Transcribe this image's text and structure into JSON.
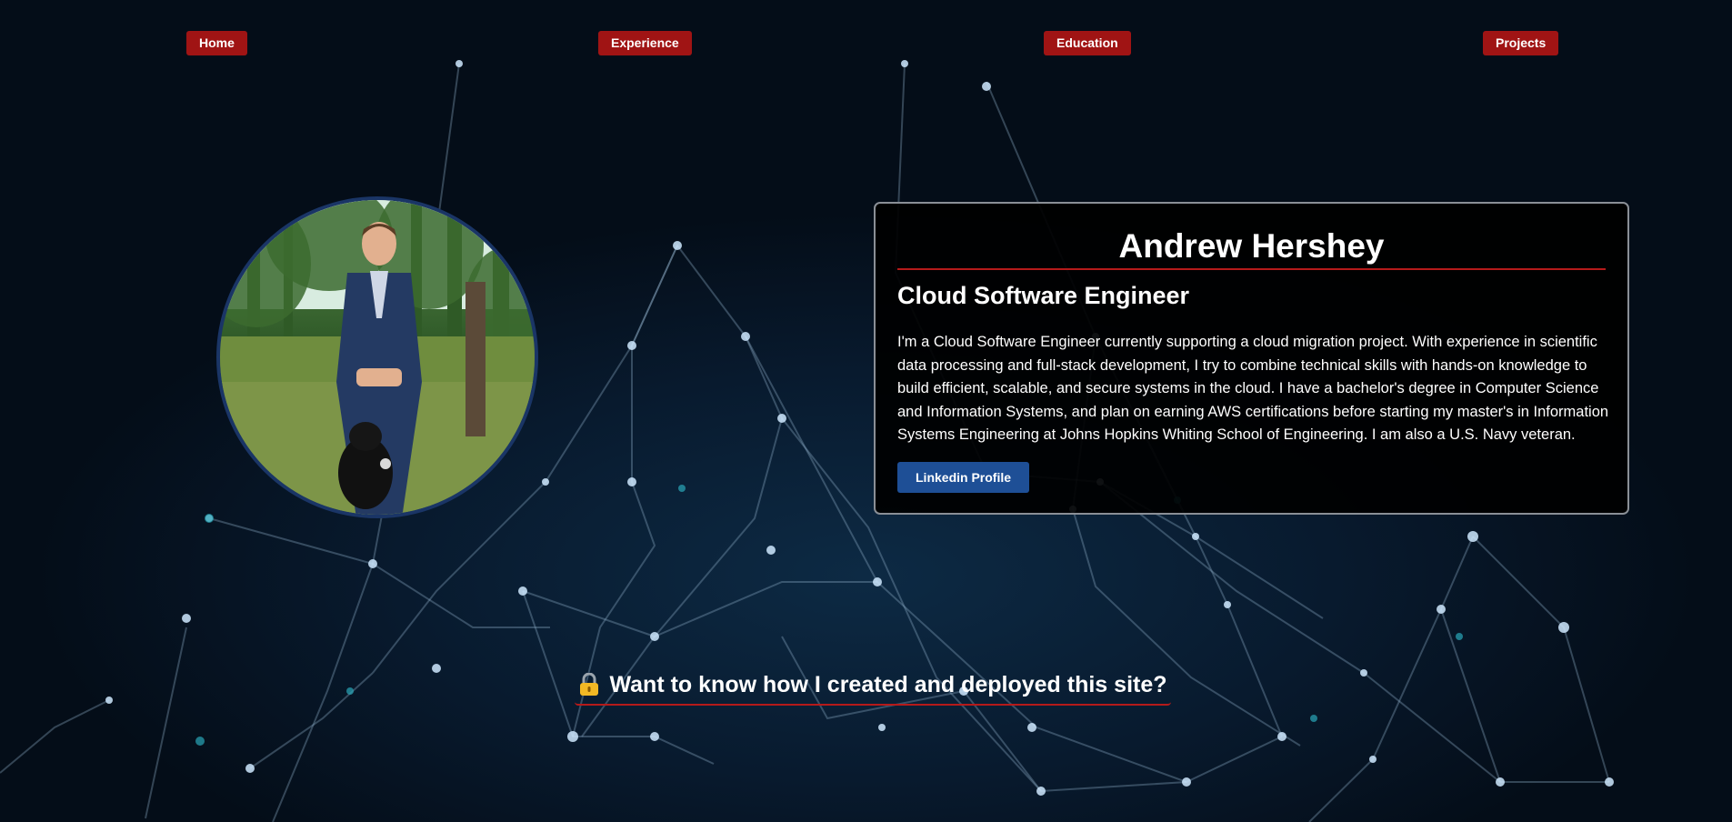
{
  "nav": {
    "home": "Home",
    "experience": "Experience",
    "education": "Education",
    "projects": "Projects"
  },
  "profile": {
    "name": "Andrew Hershey",
    "role": "Cloud Software Engineer",
    "bio": "I'm a Cloud Software Engineer currently supporting a cloud migration project. With experience in scientific data processing and full-stack development, I try to combine technical skills with hands-on knowledge to build efficient, scalable, and secure systems in the cloud. I have a bachelor's degree in Computer Science and Information Systems, and plan on earning AWS certifications before starting my master's in Information Systems Engineering at Johns Hopkins Whiting School of Engineering. I am also a U.S. Navy veteran.",
    "linkedin_label": "Linkedin Profile"
  },
  "cta": {
    "text": "Want to know how I created and deployed this site?",
    "icon": "lock-icon"
  },
  "colors": {
    "accent_red": "#a01414",
    "button_blue": "#1e4f96",
    "background": "#04101c"
  }
}
